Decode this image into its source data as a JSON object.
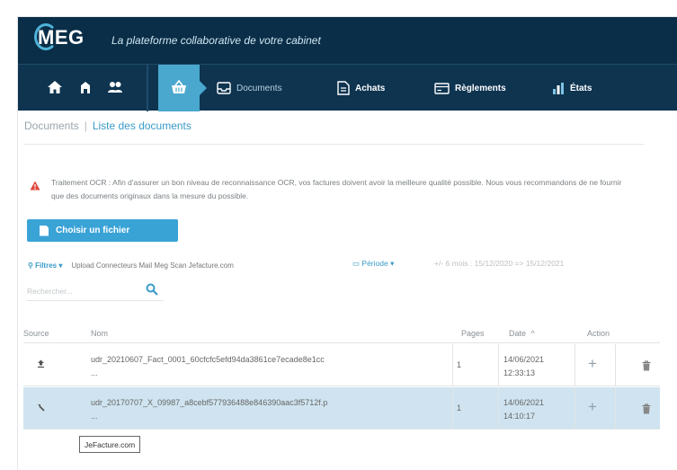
{
  "app": {
    "logo": "MEG",
    "tagline": "La plateforme collaborative de votre cabinet"
  },
  "nav": {
    "items": [
      {
        "label": "Documents",
        "icon": "inbox-tray-icon"
      },
      {
        "label": "Achats",
        "icon": "document-icon"
      },
      {
        "label": "Règlements",
        "icon": "card-icon"
      },
      {
        "label": "États",
        "icon": "bar-chart-icon"
      }
    ],
    "active": "basket-icon"
  },
  "breadcrumb": {
    "parent": "Documents",
    "separator": "|",
    "current": "Liste des documents"
  },
  "warning": {
    "text": "Traitement OCR : Afin d'assurer un bon niveau de reconnaissance OCR, vos factures doivent avoir la meilleure qualité possible. Nous vous recommandons de ne fournir que des documents originaux dans la mesure du possible."
  },
  "actions": {
    "choose_file": "Choisir un fichier"
  },
  "filters": {
    "label": "Filtres",
    "arrow": "▾",
    "tags": "Upload Connecteurs Mail Meg Scan Jefacture.com",
    "periode_label": "Période",
    "periode_value": "+/- 6 mois : 15/12/2020 => 15/12/2021"
  },
  "search": {
    "placeholder": "Rechercher..."
  },
  "table": {
    "headers": {
      "source": "Source",
      "nom": "Nom",
      "pages": "Pages",
      "date": "Date",
      "date_sort": "^",
      "action": "Action"
    },
    "rows": [
      {
        "source_icon": "upload-icon",
        "nom": "udr_20210607_Fact_0001_60cfcfc5efd94da3861ce7ecade8e1cc",
        "nom_more": "...",
        "pages": "1",
        "date": "14/06/2021",
        "time": "12:33:13"
      },
      {
        "source_icon": "link-icon",
        "nom": "udr_20170707_X_09987_a8cebf577936488e846390aac3f5712f.p",
        "nom_more": "...",
        "pages": "1",
        "date": "14/06/2021",
        "time": "14:10:17"
      }
    ]
  },
  "tooltip": {
    "text": "JeFacture.com"
  },
  "colors": {
    "topbar": "#0a2e47",
    "navbar": "#0e3450",
    "accent": "#3aa3d6",
    "warning": "#e0473a",
    "selected_row": "#cfe4f0"
  }
}
